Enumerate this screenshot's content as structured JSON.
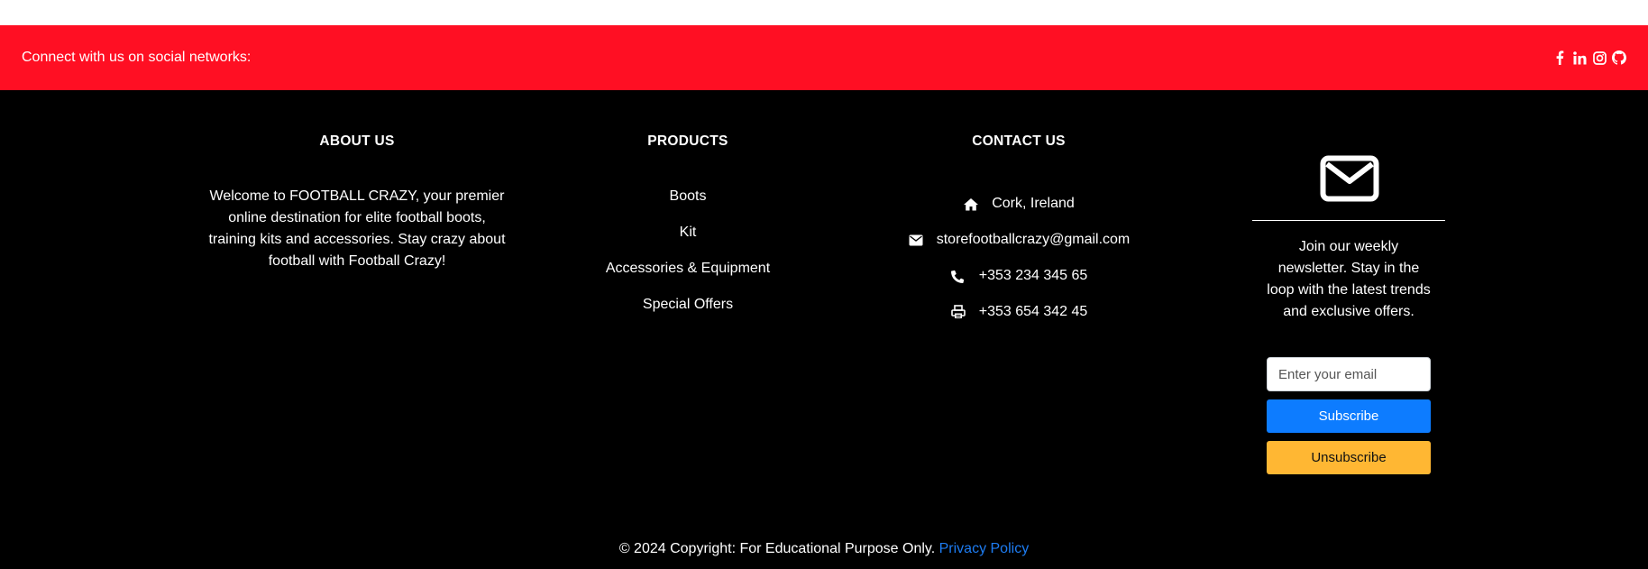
{
  "social": {
    "text": "Connect with us on social networks:",
    "icons": [
      "facebook-icon",
      "linkedin-icon",
      "instagram-icon",
      "github-icon"
    ]
  },
  "about": {
    "title": "ABOUT US",
    "text": "Welcome to FOOTBALL CRAZY, your premier online destination for elite football boots, training kits and accessories. Stay crazy about football with Football Crazy!"
  },
  "products": {
    "title": "PRODUCTS",
    "items": [
      "Boots",
      "Kit",
      "Accessories & Equipment",
      "Special Offers"
    ]
  },
  "contact": {
    "title": "CONTACT US",
    "address": "Cork, Ireland",
    "email": "storefootballcrazy@gmail.com",
    "phone": "+353 234 345 65",
    "fax": "+353 654 342 45"
  },
  "newsletter": {
    "text": "Join our weekly newsletter. Stay in the loop with the latest trends and exclusive offers.",
    "email_placeholder": "Enter your email",
    "subscribe_label": "Subscribe",
    "unsubscribe_label": "Unsubscribe"
  },
  "footer": {
    "copyright": "© 2024 Copyright: For Educational Purpose Only.",
    "privacy_label": "Privacy Policy"
  },
  "colors": {
    "social_bar": "#ff0f23",
    "footer_bg": "#000000",
    "subscribe": "#0d7cff",
    "unsubscribe": "#ffb733",
    "link": "#1d7cf2"
  }
}
